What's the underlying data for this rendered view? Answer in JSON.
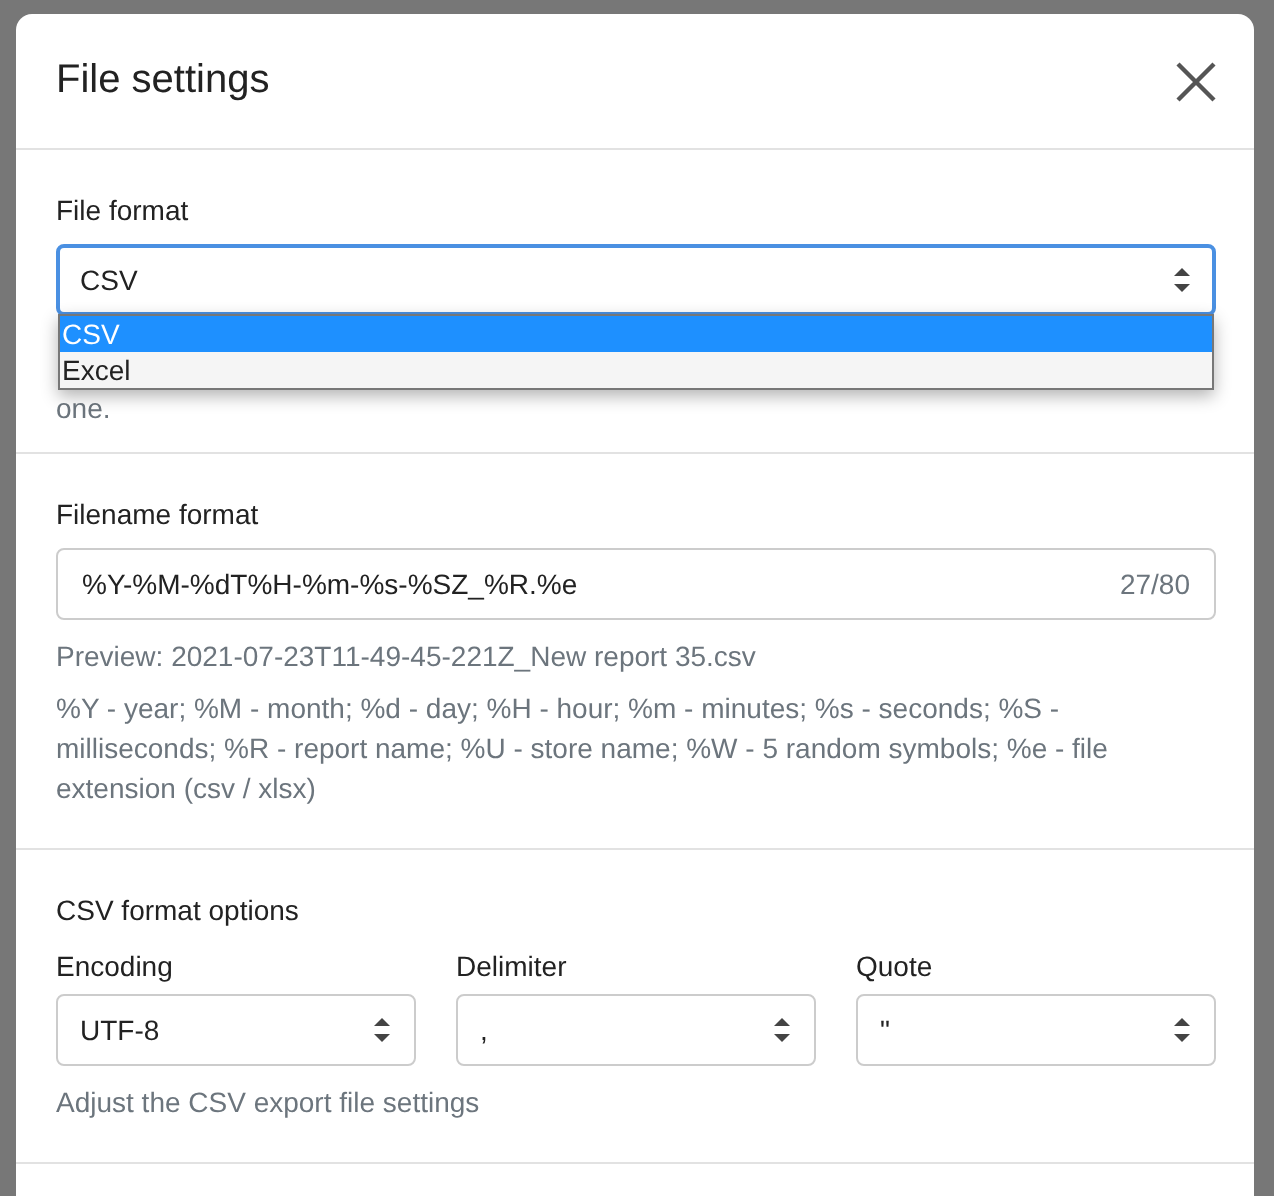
{
  "dialog": {
    "title": "File settings"
  },
  "file_format": {
    "label": "File format",
    "value": "CSV",
    "hint": "one.",
    "dropdown_open": true,
    "options": [
      {
        "label": "CSV",
        "selected": true
      },
      {
        "label": "Excel",
        "selected": false
      }
    ]
  },
  "filename_format": {
    "label": "Filename format",
    "value": "%Y-%M-%dT%H-%m-%s-%SZ_%R.%e",
    "counter": "27/80",
    "preview": "Preview: 2021-07-23T11-49-45-221Z_New report 35.csv",
    "help": "%Y - year; %M - month; %d - day; %H - hour; %m - minutes; %s - seconds; %S - milliseconds; %R - report name; %U - store name; %W - 5 random symbols; %e - file extension (csv / xlsx)"
  },
  "csv_options": {
    "title": "CSV format options",
    "fields": [
      {
        "label": "Encoding",
        "value": "UTF-8"
      },
      {
        "label": "Delimiter",
        "value": ","
      },
      {
        "label": "Quote",
        "value": "\""
      }
    ],
    "hint": "Adjust the CSV export file settings"
  }
}
